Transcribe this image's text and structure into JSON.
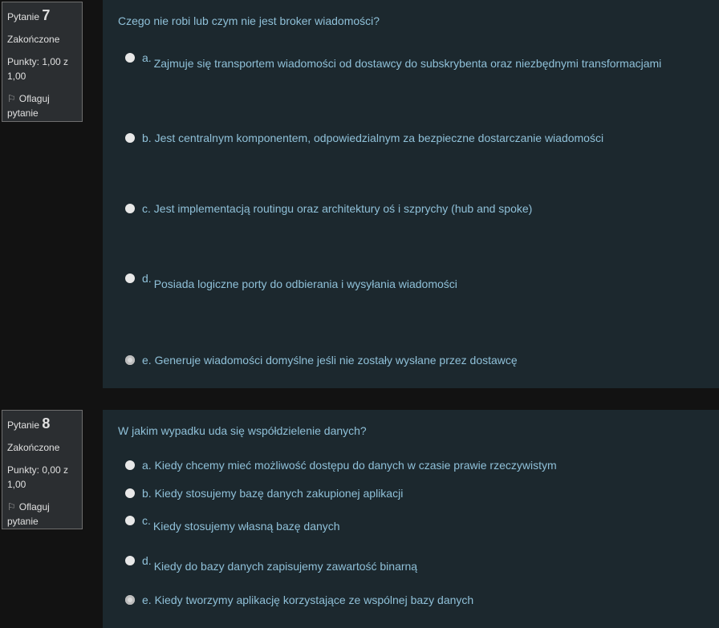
{
  "questions": [
    {
      "label": "Pytanie",
      "number": "7",
      "status": "Zakończone",
      "points": "Punkty: 1,00 z 1,00",
      "flag": "Oflaguj pytanie",
      "text": "Czego nie robi lub czym nie jest broker wiadomości?",
      "options": [
        {
          "letter": "a.",
          "text": "Zajmuje się transportem wiadomości od dostawcy do subskrybenta oraz niezbędnymi transformacjami",
          "checked": false
        },
        {
          "letter": "b.",
          "text": "Jest centralnym komponentem, odpowiedzialnym za bezpieczne dostarczanie wiadomości",
          "checked": false
        },
        {
          "letter": "c.",
          "text": "Jest implementacją routingu oraz architektury oś i szprychy (hub and spoke)",
          "checked": false
        },
        {
          "letter": "d.",
          "text": "Posiada logiczne porty do odbierania i wysyłania wiadomości",
          "checked": false
        },
        {
          "letter": "e.",
          "text": "Generuje wiadomości domyślne jeśli nie zostały wysłane przez dostawcę",
          "checked": true
        }
      ]
    },
    {
      "label": "Pytanie",
      "number": "8",
      "status": "Zakończone",
      "points": "Punkty: 0,00 z 1,00",
      "flag": "Oflaguj pytanie",
      "text": "W jakim wypadku uda się współdzielenie danych?",
      "options": [
        {
          "letter": "a.",
          "text": "Kiedy chcemy mieć możliwość dostępu do danych w czasie prawie rzeczywistym",
          "checked": false
        },
        {
          "letter": "b.",
          "text": "Kiedy stosujemy bazę danych zakupionej aplikacji",
          "checked": false
        },
        {
          "letter": "c.",
          "text": "Kiedy stosujemy własną bazę danych",
          "checked": false
        },
        {
          "letter": "d.",
          "text": "Kiedy do bazy danych zapisujemy zawartość binarną",
          "checked": false
        },
        {
          "letter": "e.",
          "text": "Kiedy tworzymy aplikację korzystające ze wspólnej bazy danych",
          "checked": true
        }
      ]
    }
  ]
}
